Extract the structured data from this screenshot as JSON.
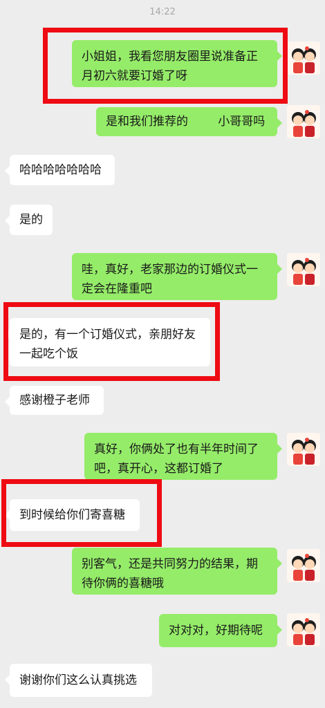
{
  "header": {
    "time": "14:22"
  },
  "messages": [
    {
      "side": "out",
      "text": "小姐姐，我看您朋友圈里说准备正\n月初六就要订婚了呀"
    },
    {
      "side": "out",
      "text": "是和我们推荐的        小哥哥吗"
    },
    {
      "side": "in",
      "text": "哈哈哈哈哈哈哈"
    },
    {
      "side": "in",
      "text": "是的"
    },
    {
      "side": "out",
      "text": "哇，真好，老家那边的订婚仪式一\n定会在隆重吧"
    },
    {
      "side": "in",
      "text": "是的，有一个订婚仪式，亲朋好友\n一起吃个饭"
    },
    {
      "side": "in",
      "text": "感谢橙子老师"
    },
    {
      "side": "out",
      "text": "真好，你俩处了也有半年时间了\n吧，真开心，这都订婚了"
    },
    {
      "side": "in",
      "text": "到时候给你们寄喜糖"
    },
    {
      "side": "out",
      "text": "别客气，还是共同努力的结果，期\n待你俩的喜糖哦"
    },
    {
      "side": "out",
      "text": "对对对，好期待呢"
    },
    {
      "side": "in",
      "text": "谢谢你们这么认真挑选"
    }
  ],
  "colors": {
    "outgoing_bubble": "#95ec69",
    "incoming_bubble": "#ffffff",
    "highlight_box": "#ee0b13",
    "background": "#ededed"
  },
  "avatar_icon": "couple-cartoon-avatar"
}
